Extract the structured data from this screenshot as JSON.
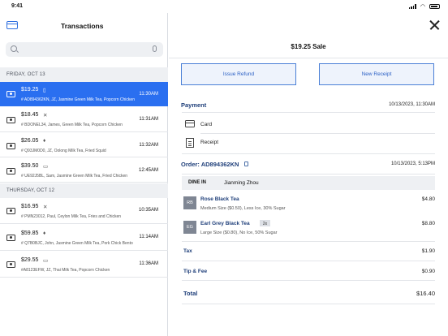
{
  "status": {
    "time": "9:41"
  },
  "left": {
    "title": "Transactions",
    "search_placeholder": "",
    "groups": [
      {
        "label": "FRIDAY, OCT 13",
        "items": [
          {
            "amount": "$19.25",
            "desc": "# AD894362KN, JZ, Jasmine Green Milk Tea, Popcorn Chicken",
            "time": "11:30AM",
            "badge": "▯"
          },
          {
            "amount": "$18.45",
            "desc": "# BDONEL34, James, Green Milk Tea, Popcorn Chicken",
            "time": "11:31AM",
            "badge": "✕"
          },
          {
            "amount": "$26.05",
            "desc": "# Q93JM0D0, JZ, Oolong Milk Tea, Fried Squid",
            "time": "11:32AM",
            "badge": "♦"
          },
          {
            "amount": "$39.50",
            "desc": "# UE92J5BL, Sam, Jasmine Green Milk Tea, Fried Chicken",
            "time": "12:45AM",
            "badge": "▭"
          }
        ]
      },
      {
        "label": "THURSDAY, OCT 12",
        "items": [
          {
            "amount": "$16.95",
            "desc": "# PMN23012, Paul, Ceylon Milk Tea, Fries and Chicken",
            "time": "10:35AM",
            "badge": "✕"
          },
          {
            "amount": "$59.85",
            "desc": "# Q7B0BJC, John, Jasmine Green Milk Tea, Pork Chick Bento",
            "time": "11:14AM",
            "badge": "♦"
          },
          {
            "amount": "$29.55",
            "desc": "#A8123EFW, JZ, Thai Milk Tea, Popcorn Chicken",
            "time": "11:36AM",
            "badge": "▭"
          }
        ]
      }
    ]
  },
  "right": {
    "sale_title": "$19.25 Sale",
    "issue_refund": "Issue Refund",
    "new_receipt": "New Receipt",
    "payment": {
      "title": "Payment",
      "date": "10/13/2023, 11:30AM",
      "card_label": "Card",
      "receipt_label": "Receipt"
    },
    "order": {
      "title": "Order: AD894362KN",
      "date": "10/13/2023, 5:13PM",
      "dine_tag": "DINE IN",
      "customer": "Jianming Zhou",
      "items": [
        {
          "thumb": "RB",
          "name": "Rose Black Tea",
          "mods": "Medium Size ($0.50), Less Ice, 30% Sugar",
          "price": "$4.80",
          "qty": ""
        },
        {
          "thumb": "EG",
          "name": "Earl Grey Black Tea",
          "mods": "Large Size ($0.80), No Ice, 50% Sugar",
          "price": "$8.80",
          "qty": "2x"
        }
      ],
      "tax_label": "Tax",
      "tax": "$1.90",
      "tip_label": "Tip & Fee",
      "tip": "$0.90",
      "total_label": "Total",
      "total": "$16.40"
    }
  }
}
